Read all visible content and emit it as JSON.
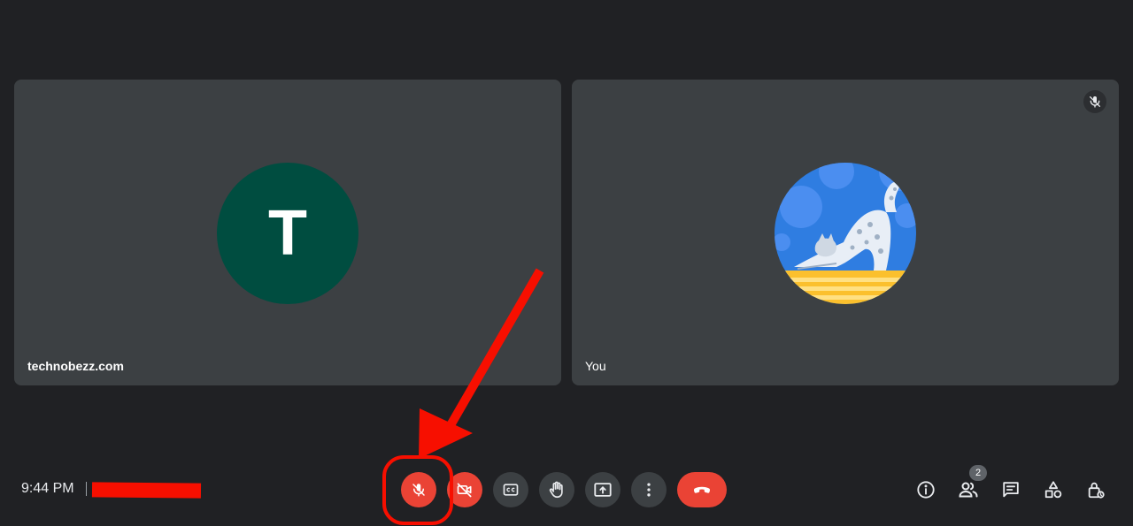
{
  "participants": [
    {
      "name": "technobezz.com",
      "avatar_letter": "T",
      "avatar_color": "#004d40"
    },
    {
      "name": "You",
      "avatar_icon": "cat-stretching-avatar-icon",
      "muted_icon": "mic-off-icon"
    }
  ],
  "footer": {
    "time": "9:44 PM",
    "participant_count": "2"
  },
  "controls": {
    "mic": "mic-off-icon",
    "camera": "camera-off-icon",
    "captions": "closed-captions-icon",
    "hand": "raise-hand-icon",
    "present": "present-screen-icon",
    "more": "more-options-icon",
    "leave": "hang-up-icon"
  },
  "side_tools": [
    "info-icon",
    "people-icon",
    "chat-icon",
    "activities-icon",
    "host-controls-icon"
  ],
  "colors": {
    "background": "#202124",
    "tile": "#3c4043",
    "danger": "#ea4335",
    "annotation": "#f70f00"
  }
}
